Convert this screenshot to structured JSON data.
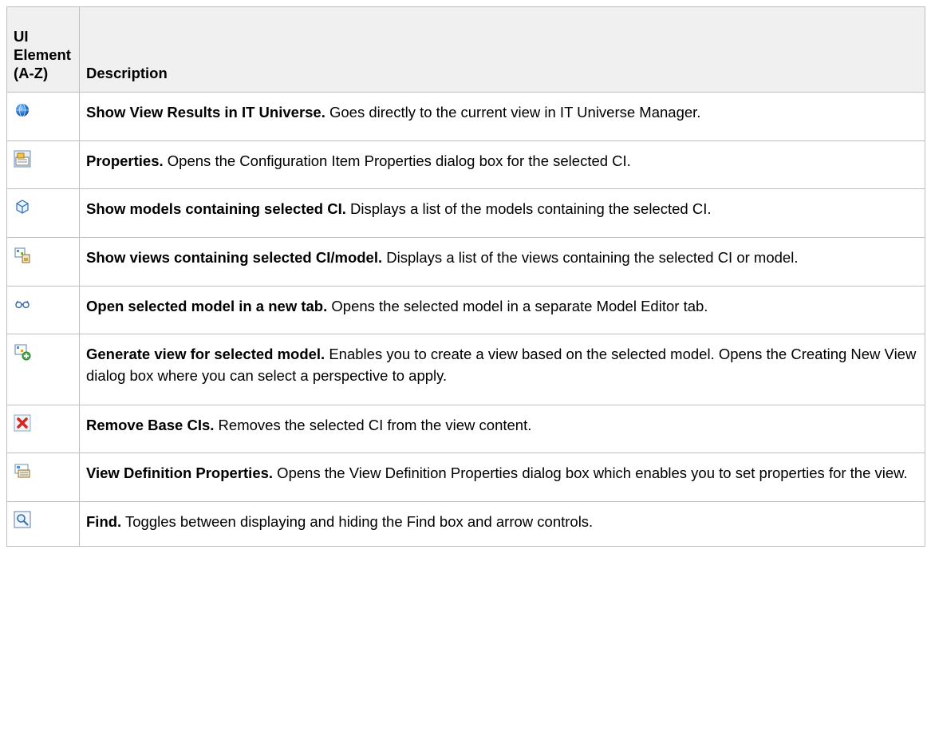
{
  "table": {
    "headers": {
      "element": "UI Element (A-Z)",
      "description": "Description"
    },
    "rows": [
      {
        "icon": "globe-icon",
        "name": "Show View Results in IT Universe.",
        "text": " Goes directly to the current view in IT Universe Manager."
      },
      {
        "icon": "properties-icon",
        "name": "Properties.",
        "text": " Opens the Configuration Item Properties dialog box for the selected CI."
      },
      {
        "icon": "cube-icon",
        "name": "Show models containing selected CI.",
        "text": " Displays a list of the models containing the selected CI."
      },
      {
        "icon": "views-icon",
        "name": "Show views containing selected CI/model.",
        "text": " Displays a list of the views containing the selected CI or model."
      },
      {
        "icon": "glasses-icon",
        "name": "Open selected model in a new tab.",
        "text": " Opens the selected model in a separate Model Editor tab."
      },
      {
        "icon": "generate-view-icon",
        "name": "Generate view for selected model.",
        "text": " Enables you to create a view based on the selected model. Opens the Creating New View dialog box where you can select a perspective to apply."
      },
      {
        "icon": "remove-icon",
        "name": "Remove Base CIs.",
        "text": " Removes the selected CI from the view content."
      },
      {
        "icon": "view-definition-icon",
        "name": "View Definition Properties.",
        "text": " Opens the View Definition Properties dialog box which enables you to set properties for the view."
      },
      {
        "icon": "find-icon",
        "name": "Find.",
        "text": " Toggles between displaying and hiding the Find box and arrow controls."
      }
    ]
  }
}
